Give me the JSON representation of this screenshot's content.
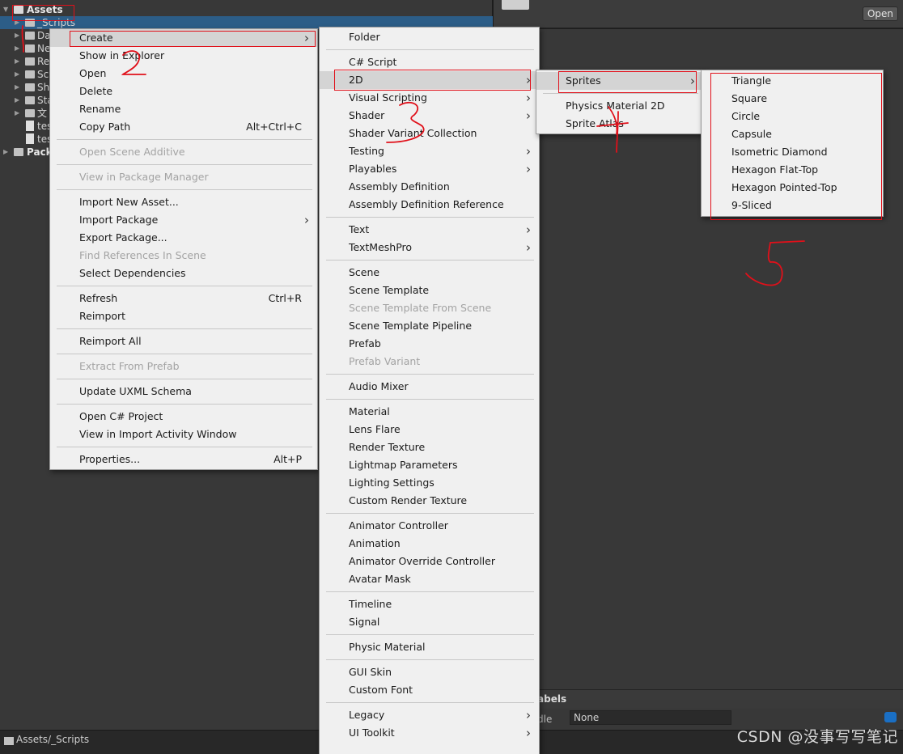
{
  "project_tree": {
    "root": "Assets",
    "rows": [
      {
        "label": "_Scripts",
        "type": "folder"
      },
      {
        "label": "Da",
        "type": "folder"
      },
      {
        "label": "Ne",
        "type": "folder"
      },
      {
        "label": "Re",
        "type": "folder"
      },
      {
        "label": "Sc",
        "type": "folder"
      },
      {
        "label": "Sh",
        "type": "folder"
      },
      {
        "label": "Sta",
        "type": "folder"
      },
      {
        "label": "文",
        "type": "folder"
      },
      {
        "label": "tes",
        "type": "file"
      },
      {
        "label": "tes",
        "type": "file"
      }
    ],
    "packages": "Pack"
  },
  "inspector": {
    "open_button": "Open"
  },
  "labels_panel": {
    "title": "abels",
    "bundle_label": "dle",
    "bundle_value": "None"
  },
  "status_bar": {
    "path": "Assets/_Scripts"
  },
  "watermark": "CSDN @没事写写笔记",
  "context_menu": {
    "items": [
      {
        "label": "Create",
        "submenu": true,
        "highlight": true
      },
      {
        "label": "Show in Explorer"
      },
      {
        "label": "Open"
      },
      {
        "label": "Delete"
      },
      {
        "label": "Rename"
      },
      {
        "label": "Copy Path",
        "shortcut": "Alt+Ctrl+C"
      },
      {
        "sep": true
      },
      {
        "label": "Open Scene Additive",
        "disabled": true
      },
      {
        "sep": true
      },
      {
        "label": "View in Package Manager",
        "disabled": true
      },
      {
        "sep": true
      },
      {
        "label": "Import New Asset..."
      },
      {
        "label": "Import Package",
        "submenu": true
      },
      {
        "label": "Export Package..."
      },
      {
        "label": "Find References In Scene",
        "disabled": true
      },
      {
        "label": "Select Dependencies"
      },
      {
        "sep": true
      },
      {
        "label": "Refresh",
        "shortcut": "Ctrl+R"
      },
      {
        "label": "Reimport"
      },
      {
        "sep": true
      },
      {
        "label": "Reimport All"
      },
      {
        "sep": true
      },
      {
        "label": "Extract From Prefab",
        "disabled": true
      },
      {
        "sep": true
      },
      {
        "label": "Update UXML Schema"
      },
      {
        "sep": true
      },
      {
        "label": "Open C# Project"
      },
      {
        "label": "View in Import Activity Window"
      },
      {
        "sep": true
      },
      {
        "label": "Properties...",
        "shortcut": "Alt+P"
      }
    ]
  },
  "create_menu": {
    "items": [
      {
        "label": "Folder"
      },
      {
        "sep": true
      },
      {
        "label": "C# Script"
      },
      {
        "label": "2D",
        "submenu": true,
        "highlight": true
      },
      {
        "label": "Visual Scripting",
        "submenu": true
      },
      {
        "label": "Shader",
        "submenu": true
      },
      {
        "label": "Shader Variant Collection"
      },
      {
        "label": "Testing",
        "submenu": true
      },
      {
        "label": "Playables",
        "submenu": true
      },
      {
        "label": "Assembly Definition"
      },
      {
        "label": "Assembly Definition Reference"
      },
      {
        "sep": true
      },
      {
        "label": "Text",
        "submenu": true
      },
      {
        "label": "TextMeshPro",
        "submenu": true
      },
      {
        "sep": true
      },
      {
        "label": "Scene"
      },
      {
        "label": "Scene Template"
      },
      {
        "label": "Scene Template From Scene",
        "disabled": true
      },
      {
        "label": "Scene Template Pipeline"
      },
      {
        "label": "Prefab"
      },
      {
        "label": "Prefab Variant",
        "disabled": true
      },
      {
        "sep": true
      },
      {
        "label": "Audio Mixer"
      },
      {
        "sep": true
      },
      {
        "label": "Material"
      },
      {
        "label": "Lens Flare"
      },
      {
        "label": "Render Texture"
      },
      {
        "label": "Lightmap Parameters"
      },
      {
        "label": "Lighting Settings"
      },
      {
        "label": "Custom Render Texture"
      },
      {
        "sep": true
      },
      {
        "label": "Animator Controller"
      },
      {
        "label": "Animation"
      },
      {
        "label": "Animator Override Controller"
      },
      {
        "label": "Avatar Mask"
      },
      {
        "sep": true
      },
      {
        "label": "Timeline"
      },
      {
        "label": "Signal"
      },
      {
        "sep": true
      },
      {
        "label": "Physic Material"
      },
      {
        "sep": true
      },
      {
        "label": "GUI Skin"
      },
      {
        "label": "Custom Font"
      },
      {
        "sep": true
      },
      {
        "label": "Legacy",
        "submenu": true
      },
      {
        "label": "UI Toolkit",
        "submenu": true
      }
    ]
  },
  "twod_menu": {
    "items": [
      {
        "label": "Sprites",
        "submenu": true,
        "highlight": true
      },
      {
        "sep": true
      },
      {
        "label": "Physics Material 2D"
      },
      {
        "label": "Sprite Atlas"
      }
    ]
  },
  "sprites_menu": {
    "items": [
      {
        "label": "Triangle"
      },
      {
        "label": "Square"
      },
      {
        "label": "Circle"
      },
      {
        "label": "Capsule"
      },
      {
        "label": "Isometric Diamond"
      },
      {
        "label": "Hexagon Flat-Top"
      },
      {
        "label": "Hexagon Pointed-Top"
      },
      {
        "label": "9-Sliced"
      }
    ]
  },
  "annotation_color": "#e0101a"
}
